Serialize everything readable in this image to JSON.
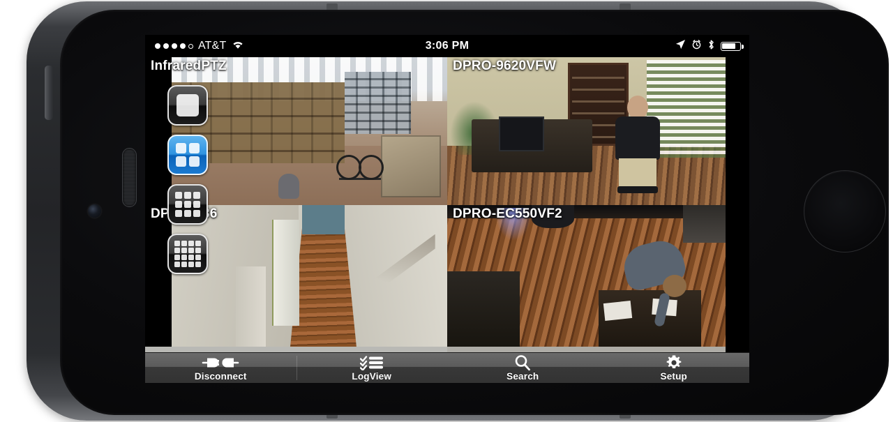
{
  "device": {
    "model_hint": "smartphone-landscape",
    "body_color": "#2b2d30"
  },
  "status_bar": {
    "signal_dots_total": 5,
    "signal_dots_filled": 4,
    "carrier": "AT&T",
    "wifi_icon": "wifi-icon",
    "time": "3:06 PM",
    "location_icon": "location-arrow-icon",
    "alarm_icon": "alarm-clock-icon",
    "bluetooth_icon": "bluetooth-icon",
    "battery_icon": "battery-icon",
    "battery_percent": 72
  },
  "layout_buttons": [
    {
      "name": "layout-1x1",
      "icon": "single-pane-icon",
      "cells": 1,
      "active": false
    },
    {
      "name": "layout-2x2",
      "icon": "quad-pane-icon",
      "cells": 4,
      "active": true
    },
    {
      "name": "layout-3x3",
      "icon": "nine-pane-icon",
      "cells": 9,
      "active": false
    },
    {
      "name": "layout-4x4",
      "icon": "sixteen-pane-icon",
      "cells": 16,
      "active": false
    }
  ],
  "cameras": [
    {
      "label": "InfraredPTZ",
      "scene": "warehouse-with-boxes-and-bicycle"
    },
    {
      "label": "DPRO-9620VFW",
      "scene": "office-with-person-standing"
    },
    {
      "label": "DPRO-L36",
      "scene": "interior-hallway-wood-floor"
    },
    {
      "label": "DPRO-EC550VF2",
      "scene": "overhead-office-person-at-desk"
    }
  ],
  "toolbar": {
    "items": [
      {
        "label": "Disconnect",
        "icon": "disconnected-plug-icon"
      },
      {
        "label": "LogView",
        "icon": "checklist-icon"
      },
      {
        "label": "Search",
        "icon": "magnifying-glass-icon"
      },
      {
        "label": "Setup",
        "icon": "gear-icon"
      }
    ]
  },
  "colors": {
    "accent_blue": "#2f93e0",
    "toolbar_top": "#6a6a6a",
    "toolbar_bottom": "#333333",
    "screen_background": "#000000"
  }
}
